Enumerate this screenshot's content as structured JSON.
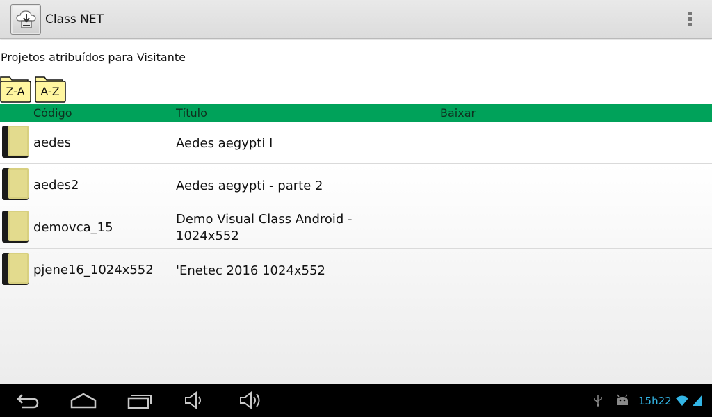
{
  "app": {
    "title": "Class NET"
  },
  "content": {
    "heading": "Projetos atribuídos para Visitante",
    "sort_desc_label": "Z-A",
    "sort_asc_label": "A-Z"
  },
  "table": {
    "headers": {
      "code": "Código",
      "title": "Título",
      "download": "Baixar"
    },
    "rows": [
      {
        "code": "aedes",
        "title": "Aedes aegypti I"
      },
      {
        "code": "aedes2",
        "title": "Aedes aegypti - parte 2"
      },
      {
        "code": "demovca_15",
        "title": "Demo Visual Class Android - 1024x552"
      },
      {
        "code": "pjene16_1024x552",
        "title": "'Enetec 2016 1024x552"
      }
    ]
  },
  "status": {
    "time": "15h22"
  },
  "colors": {
    "header_green": "#00a25a",
    "time_blue": "#33b5e5",
    "folder_yellow": "#fff6a0"
  },
  "icons": [
    "app-cloud-icon",
    "overflow-menu-icon",
    "folder-icon",
    "book-icon",
    "back-icon",
    "home-icon",
    "recent-apps-icon",
    "volume-down-icon",
    "volume-up-icon",
    "usb-icon",
    "android-debug-icon",
    "wifi-icon",
    "signal-icon"
  ]
}
